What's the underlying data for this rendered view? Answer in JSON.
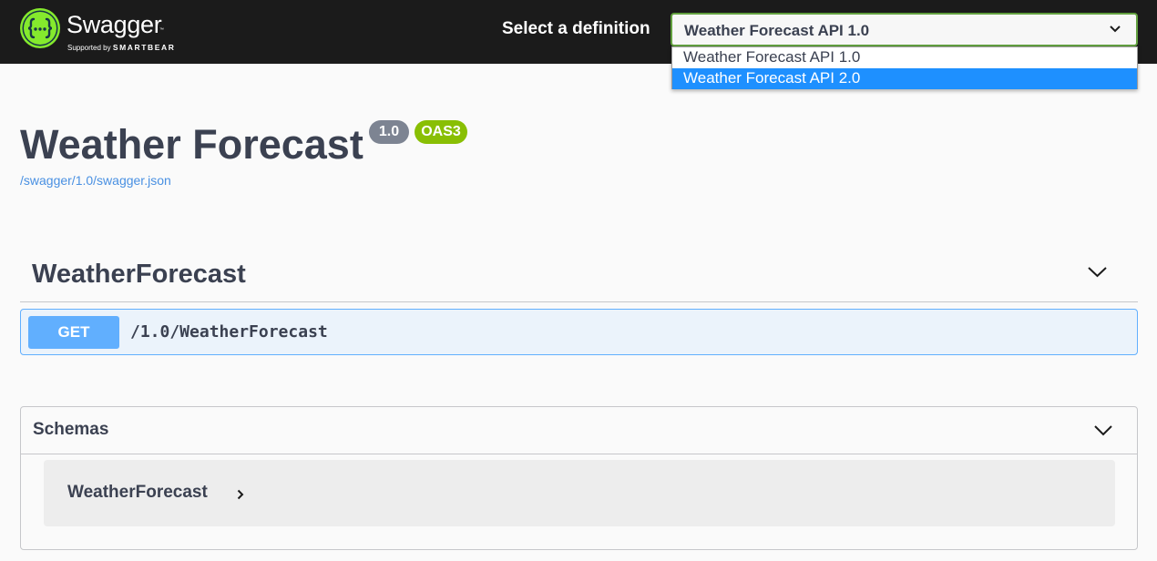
{
  "topbar": {
    "logo_icon": "swagger-logo-icon",
    "brand": "Swagger",
    "brand_tm": "™",
    "supported_by_prefix": "Supported by",
    "supported_by_company": "SMARTBEAR",
    "select_label": "Select a definition",
    "selected_definition": "Weather Forecast API 1.0",
    "chevron_icon": "chevron-down-icon",
    "options": [
      "Weather Forecast API 1.0",
      "Weather Forecast API 2.0"
    ],
    "highlighted_option": "Weather Forecast API 2.0"
  },
  "info": {
    "title": "Weather Forecast",
    "version_badge": "1.0",
    "oas_badge": "OAS3",
    "spec_url": "/swagger/1.0/swagger.json"
  },
  "tag": {
    "name": "WeatherForecast",
    "chevron_icon": "chevron-down-icon",
    "operations": [
      {
        "method": "GET",
        "path": "/1.0/WeatherForecast"
      }
    ]
  },
  "schemas": {
    "title": "Schemas",
    "chevron_icon": "chevron-down-icon",
    "models": [
      {
        "name": "WeatherForecast",
        "icon": "chevron-right-icon"
      }
    ]
  },
  "colors": {
    "topbar_bg": "#1b1b1b",
    "select_border": "#62a03f",
    "highlight": "#1e90ff",
    "get_method": "#61affe",
    "get_bg": "#ebf3fb",
    "version_badge": "#7d8492",
    "oas_badge": "#89bf04",
    "link": "#4990e2",
    "logo": "#85ea2d"
  }
}
